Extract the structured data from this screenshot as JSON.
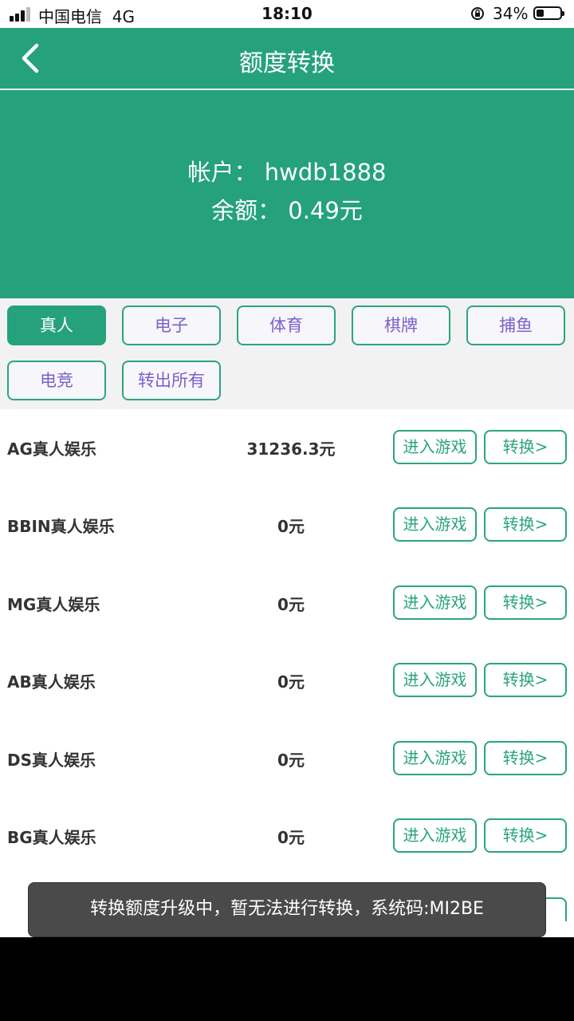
{
  "status_bar": {
    "carrier": "中国电信",
    "network": "4G",
    "time": "18:10",
    "battery": "34%"
  },
  "nav": {
    "title": "额度转换",
    "back_icon": "chevron-left-icon"
  },
  "account": {
    "account_line": "帐户： hwdb1888",
    "balance_line": "余额： 0.49元"
  },
  "tabs": [
    {
      "label": "真人",
      "active": true
    },
    {
      "label": "电子",
      "active": false
    },
    {
      "label": "体育",
      "active": false
    },
    {
      "label": "棋牌",
      "active": false
    },
    {
      "label": "捕鱼",
      "active": false
    },
    {
      "label": "电竞",
      "active": false
    },
    {
      "label": "转出所有",
      "active": false
    }
  ],
  "rows": [
    {
      "name": "AG真人娱乐",
      "amount": "31236.3元",
      "enter_label": "进入游戏",
      "transfer_label": "转换>"
    },
    {
      "name": "BBIN真人娱乐",
      "amount": "0元",
      "enter_label": "进入游戏",
      "transfer_label": "转换>"
    },
    {
      "name": "MG真人娱乐",
      "amount": "0元",
      "enter_label": "进入游戏",
      "transfer_label": "转换>"
    },
    {
      "name": "AB真人娱乐",
      "amount": "0元",
      "enter_label": "进入游戏",
      "transfer_label": "转换>"
    },
    {
      "name": "DS真人娱乐",
      "amount": "0元",
      "enter_label": "进入游戏",
      "transfer_label": "转换>"
    },
    {
      "name": "BG真人娱乐",
      "amount": "0元",
      "enter_label": "进入游戏",
      "transfer_label": "转换>"
    }
  ],
  "toast": {
    "message": "转换额度升级中，暂无法进行转换，系统码:MI2BE"
  },
  "colors": {
    "primary": "#25a27b",
    "tab_text": "#7b61c9",
    "toast_bg": "#4a4a4a"
  }
}
